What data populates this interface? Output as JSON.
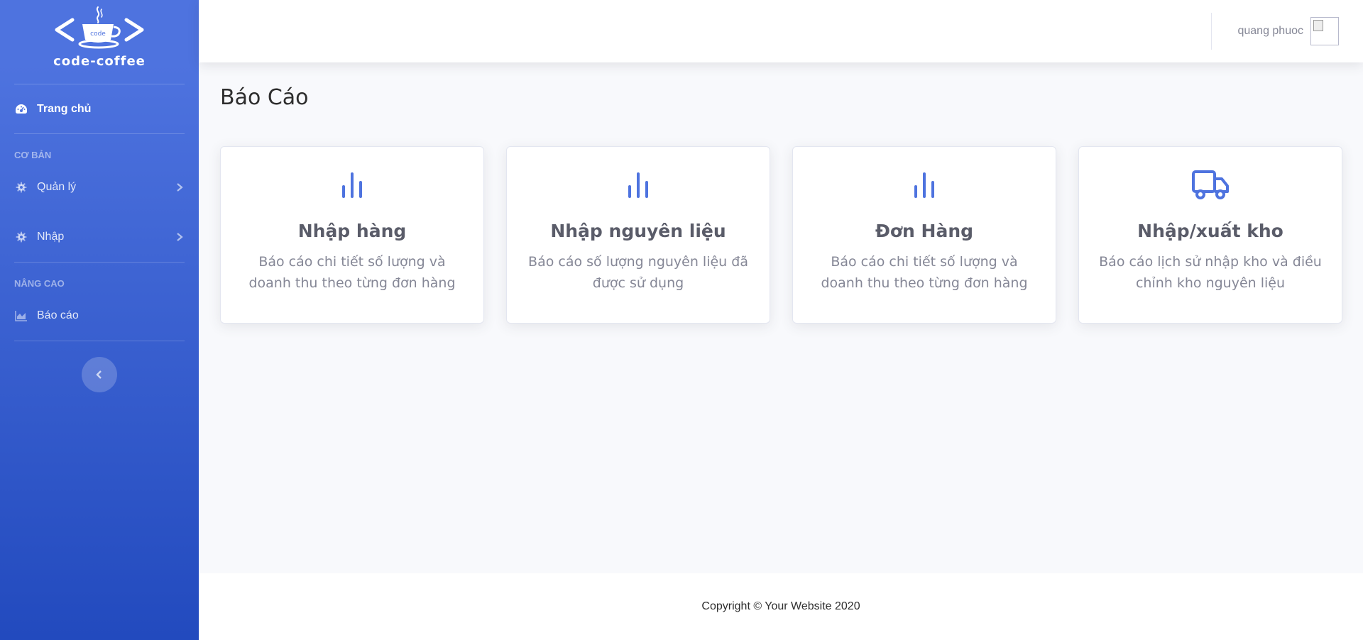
{
  "brand": {
    "name": "code-coffee",
    "logo_text": "code"
  },
  "sidebar": {
    "dashboard": {
      "label": "Trang chủ",
      "icon": "tachometer-icon"
    },
    "section_basic": "CƠ BẢN",
    "manage": {
      "label": "Quản lý",
      "icon": "gear-icon"
    },
    "import": {
      "label": "Nhập",
      "icon": "gear-icon"
    },
    "section_advanced": "NÂNG CAO",
    "reports": {
      "label": "Báo cáo",
      "icon": "area-chart-icon"
    }
  },
  "topbar": {
    "user_name": "quang phuoc"
  },
  "page": {
    "title": "Báo Cáo"
  },
  "cards": [
    {
      "title": "Nhập hàng",
      "desc": "Báo cáo chi tiết số lượng và doanh thu theo từng đơn hàng",
      "icon": "bar-chart-icon"
    },
    {
      "title": "Nhập nguyên liệu",
      "desc": "Báo cáo số lượng nguyên liệu đã được sử dụng",
      "icon": "bar-chart-icon"
    },
    {
      "title": "Đơn Hàng",
      "desc": "Báo cáo chi tiết số lượng và doanh thu theo từng đơn hàng",
      "icon": "bar-chart-icon"
    },
    {
      "title": "Nhập/xuất kho",
      "desc": "Báo cáo lịch sử nhập kho và điều chỉnh kho nguyên liệu",
      "icon": "truck-icon"
    }
  ],
  "footer": {
    "text": "Copyright © Your Website 2020"
  },
  "colors": {
    "primary": "#4e73df",
    "primary_dark": "#224abe",
    "text_muted": "#858796",
    "text_dark": "#5a5c69"
  }
}
